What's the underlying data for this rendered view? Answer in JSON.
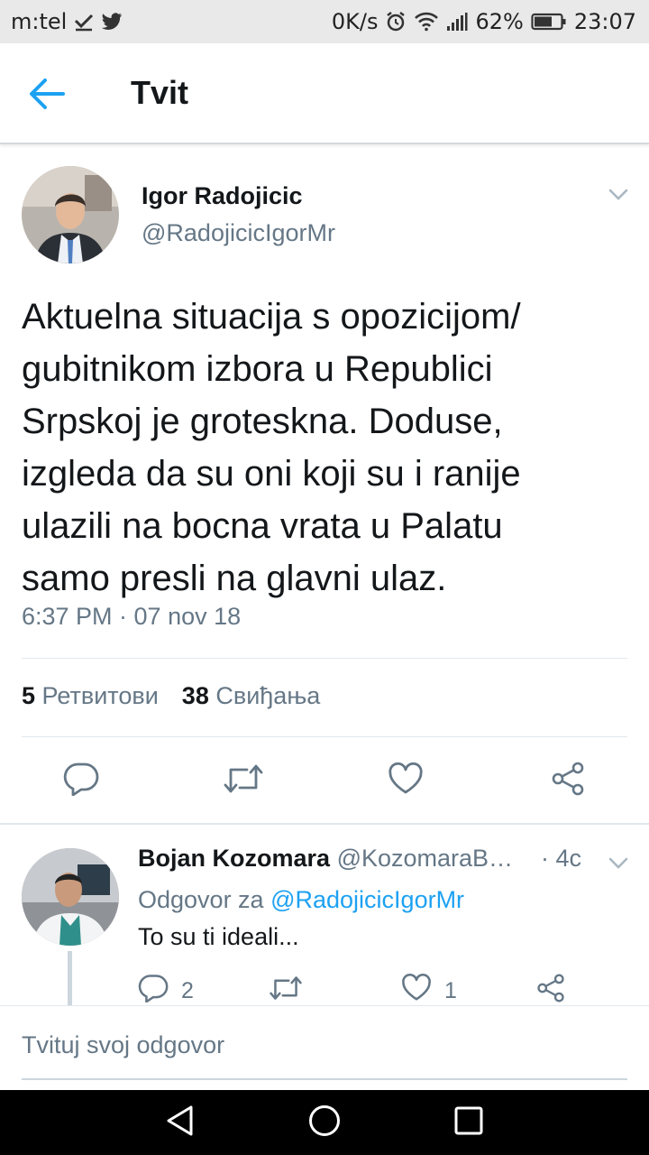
{
  "status_bar": {
    "carrier": "m:tel",
    "speed": "0K/s",
    "battery": "62%",
    "time": "23:07",
    "icons": [
      "download-check-icon",
      "twitter-bird-icon",
      "alarm-icon",
      "wifi-icon",
      "signal-icon",
      "battery-icon"
    ]
  },
  "app_bar": {
    "title": "Tvit",
    "back_icon": "arrow-left-icon"
  },
  "tweet": {
    "author_name": "Igor Radojicic",
    "author_handle": "@RadojicicIgorMr",
    "lines": [
      "Aktuelna situacija s opozicijom/",
      "gubitnikom izbora u Republici",
      "Srpskoj je groteskna. Doduse,",
      "izgleda da su oni koji su i ranije",
      "ulazili na bocna vrata u Palatu",
      "samo presli na glavni ulaz."
    ],
    "timestamp": "6:37 PM · 07 nov 18",
    "retweets_count": "5",
    "retweets_label": "Ретвитови",
    "likes_count": "38",
    "likes_label": "Свиђања",
    "actions": [
      "reply-icon",
      "retweet-icon",
      "like-icon",
      "share-icon"
    ]
  },
  "reply": {
    "author_name": "Bojan Kozomara",
    "author_handle": "@KozomaraB…",
    "time": "· 4c",
    "replying_prefix": "Odgovor za",
    "replying_to": "@RadojicicIgorMr",
    "text": "To su ti ideali...",
    "reply_count": "2",
    "like_count": "1"
  },
  "compose": {
    "placeholder": "Tvituj svoj odgovor"
  },
  "colors": {
    "accent": "#1da1f2",
    "text_primary": "#14171a",
    "text_secondary": "#657786",
    "divider": "#e1e8ed"
  }
}
